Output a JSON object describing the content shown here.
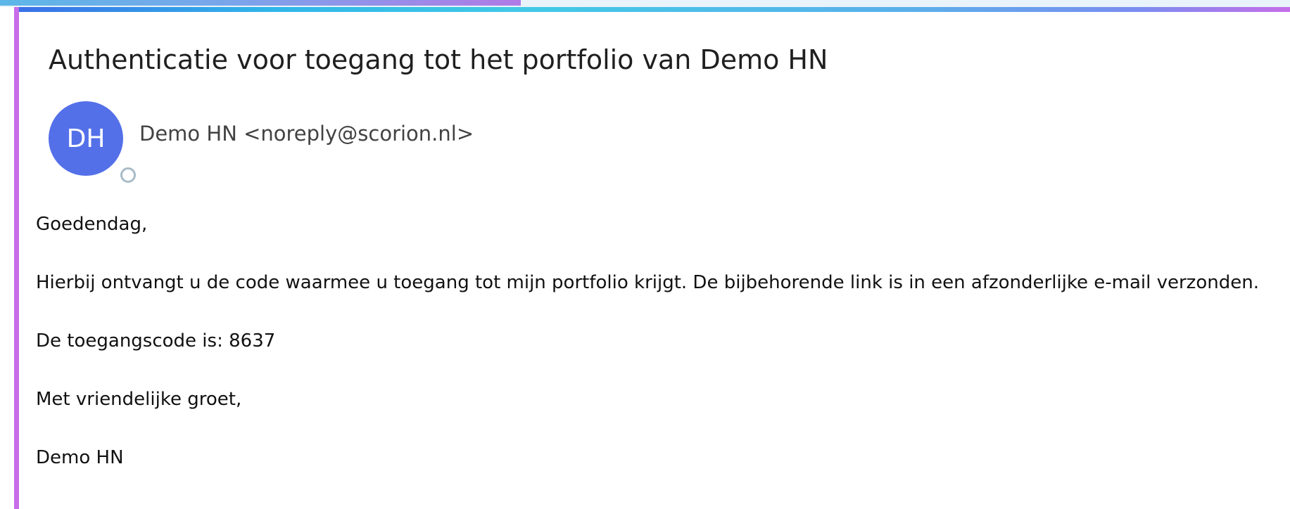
{
  "email": {
    "subject": "Authenticatie voor toegang tot het portfolio van Demo HN",
    "sender": {
      "initials": "DH",
      "display": "Demo HN <noreply@scorion.nl>",
      "avatar_color": "#5470e9"
    },
    "body": {
      "greeting": "Goedendag,",
      "intro": "Hierbij ontvangt u de code waarmee u toegang tot mijn portfolio krijgt. De bijbehorende link is in een afzonderlijke e-mail verzonden.",
      "code_line": "De toegangscode is: 8637",
      "closing": "Met vriendelijke groet,",
      "signature": "Demo HN"
    }
  },
  "colors": {
    "accent_border": "#c86ee8",
    "avatar": "#5470e9"
  }
}
